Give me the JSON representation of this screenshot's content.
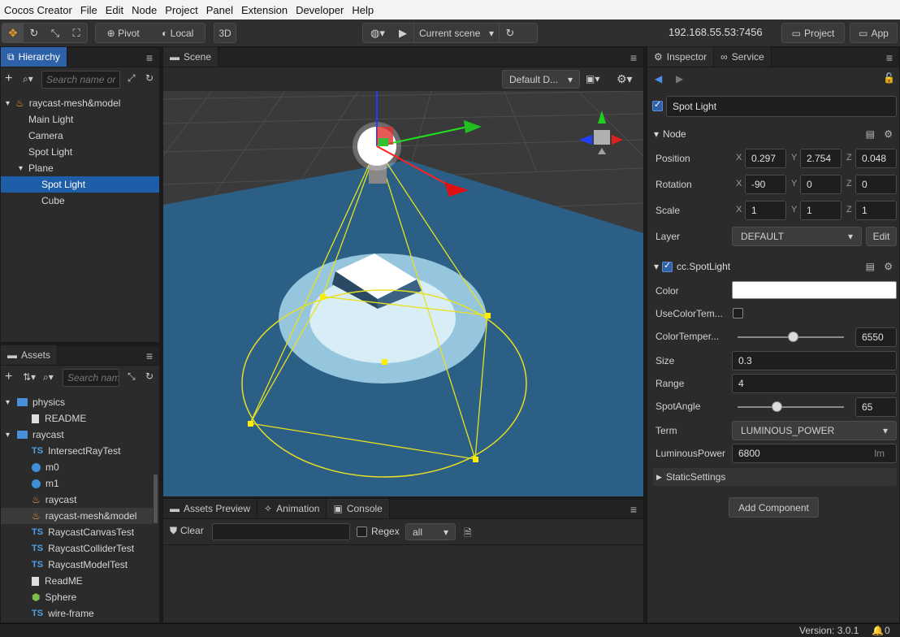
{
  "menubar": {
    "items": [
      "Cocos Creator",
      "File",
      "Edit",
      "Node",
      "Project",
      "Panel",
      "Extension",
      "Developer",
      "Help"
    ]
  },
  "toolbar": {
    "pivot_label": "Pivot",
    "local_label": "Local",
    "mode_3d": "3D",
    "scene_select": "Current scene",
    "ip_address": "192.168.55.53:7456",
    "project_button": "Project",
    "app_button": "App"
  },
  "hierarchy": {
    "tab": "Hierarchy",
    "search_placeholder": "Search name or",
    "tree": [
      {
        "label": "raycast-mesh&model",
        "depth": 0,
        "expanded": true,
        "icon": "flame-icon"
      },
      {
        "label": "Main Light",
        "depth": 1
      },
      {
        "label": "Camera",
        "depth": 1
      },
      {
        "label": "Spot Light",
        "depth": 1
      },
      {
        "label": "Plane",
        "depth": 1,
        "expanded": true
      },
      {
        "label": "Spot Light",
        "depth": 2,
        "selected": true
      },
      {
        "label": "Cube",
        "depth": 2
      }
    ]
  },
  "assets": {
    "tab": "Assets",
    "search_placeholder": "Search name",
    "tree": [
      {
        "label": "physics",
        "type": "folder",
        "depth": 1
      },
      {
        "label": "README",
        "type": "file",
        "depth": 2
      },
      {
        "label": "raycast",
        "type": "folder",
        "depth": 1
      },
      {
        "label": "IntersectRayTest",
        "type": "ts",
        "depth": 2
      },
      {
        "label": "m0",
        "type": "material",
        "depth": 2
      },
      {
        "label": "m1",
        "type": "material",
        "depth": 2
      },
      {
        "label": "raycast",
        "type": "scene",
        "depth": 2
      },
      {
        "label": "raycast-mesh&model",
        "type": "scene",
        "depth": 2,
        "highlighted": true
      },
      {
        "label": "RaycastCanvasTest",
        "type": "ts",
        "depth": 2
      },
      {
        "label": "RaycastColliderTest",
        "type": "ts",
        "depth": 2
      },
      {
        "label": "RaycastModelTest",
        "type": "ts",
        "depth": 2
      },
      {
        "label": "ReadME",
        "type": "file",
        "depth": 2
      },
      {
        "label": "Sphere",
        "type": "prefab",
        "depth": 2
      },
      {
        "label": "wire-frame",
        "type": "ts",
        "depth": 2
      }
    ]
  },
  "scene": {
    "tab": "Scene",
    "camera_select": "Default D..."
  },
  "console": {
    "tabs": [
      "Assets Preview",
      "Animation",
      "Console"
    ],
    "clear_label": "Clear",
    "regex_label": "Regex",
    "filter_value": "all"
  },
  "inspector": {
    "tabs": [
      "Inspector",
      "Service"
    ],
    "node_name": "Spot Light",
    "node_section": "Node",
    "position": {
      "label": "Position",
      "x": "0.297",
      "y": "2.754",
      "z": "0.048"
    },
    "rotation": {
      "label": "Rotation",
      "x": "-90",
      "y": "0",
      "z": "0"
    },
    "scale": {
      "label": "Scale",
      "x": "1",
      "y": "1",
      "z": "1"
    },
    "layer": {
      "label": "Layer",
      "value": "DEFAULT",
      "edit": "Edit"
    },
    "component": "cc.SpotLight",
    "color_label": "Color",
    "use_color_temp_label": "UseColorTem...",
    "color_temp_label": "ColorTemper...",
    "color_temp_value": "6550",
    "color_temp_fraction": 0.52,
    "size_label": "Size",
    "size_value": "0.3",
    "range_label": "Range",
    "range_value": "4",
    "spot_angle_label": "SpotAngle",
    "spot_angle_value": "65",
    "spot_angle_fraction": 0.37,
    "term_label": "Term",
    "term_value": "LUMINOUS_POWER",
    "luminous_label": "LuminousPower",
    "luminous_value": "6800",
    "luminous_unit": "lm",
    "static_settings": "StaticSettings",
    "add_component": "Add Component",
    "axis_x": "X",
    "axis_y": "Y",
    "axis_z": "Z"
  },
  "statusbar": {
    "version": "Version: 3.0.1",
    "notifications": "0"
  }
}
